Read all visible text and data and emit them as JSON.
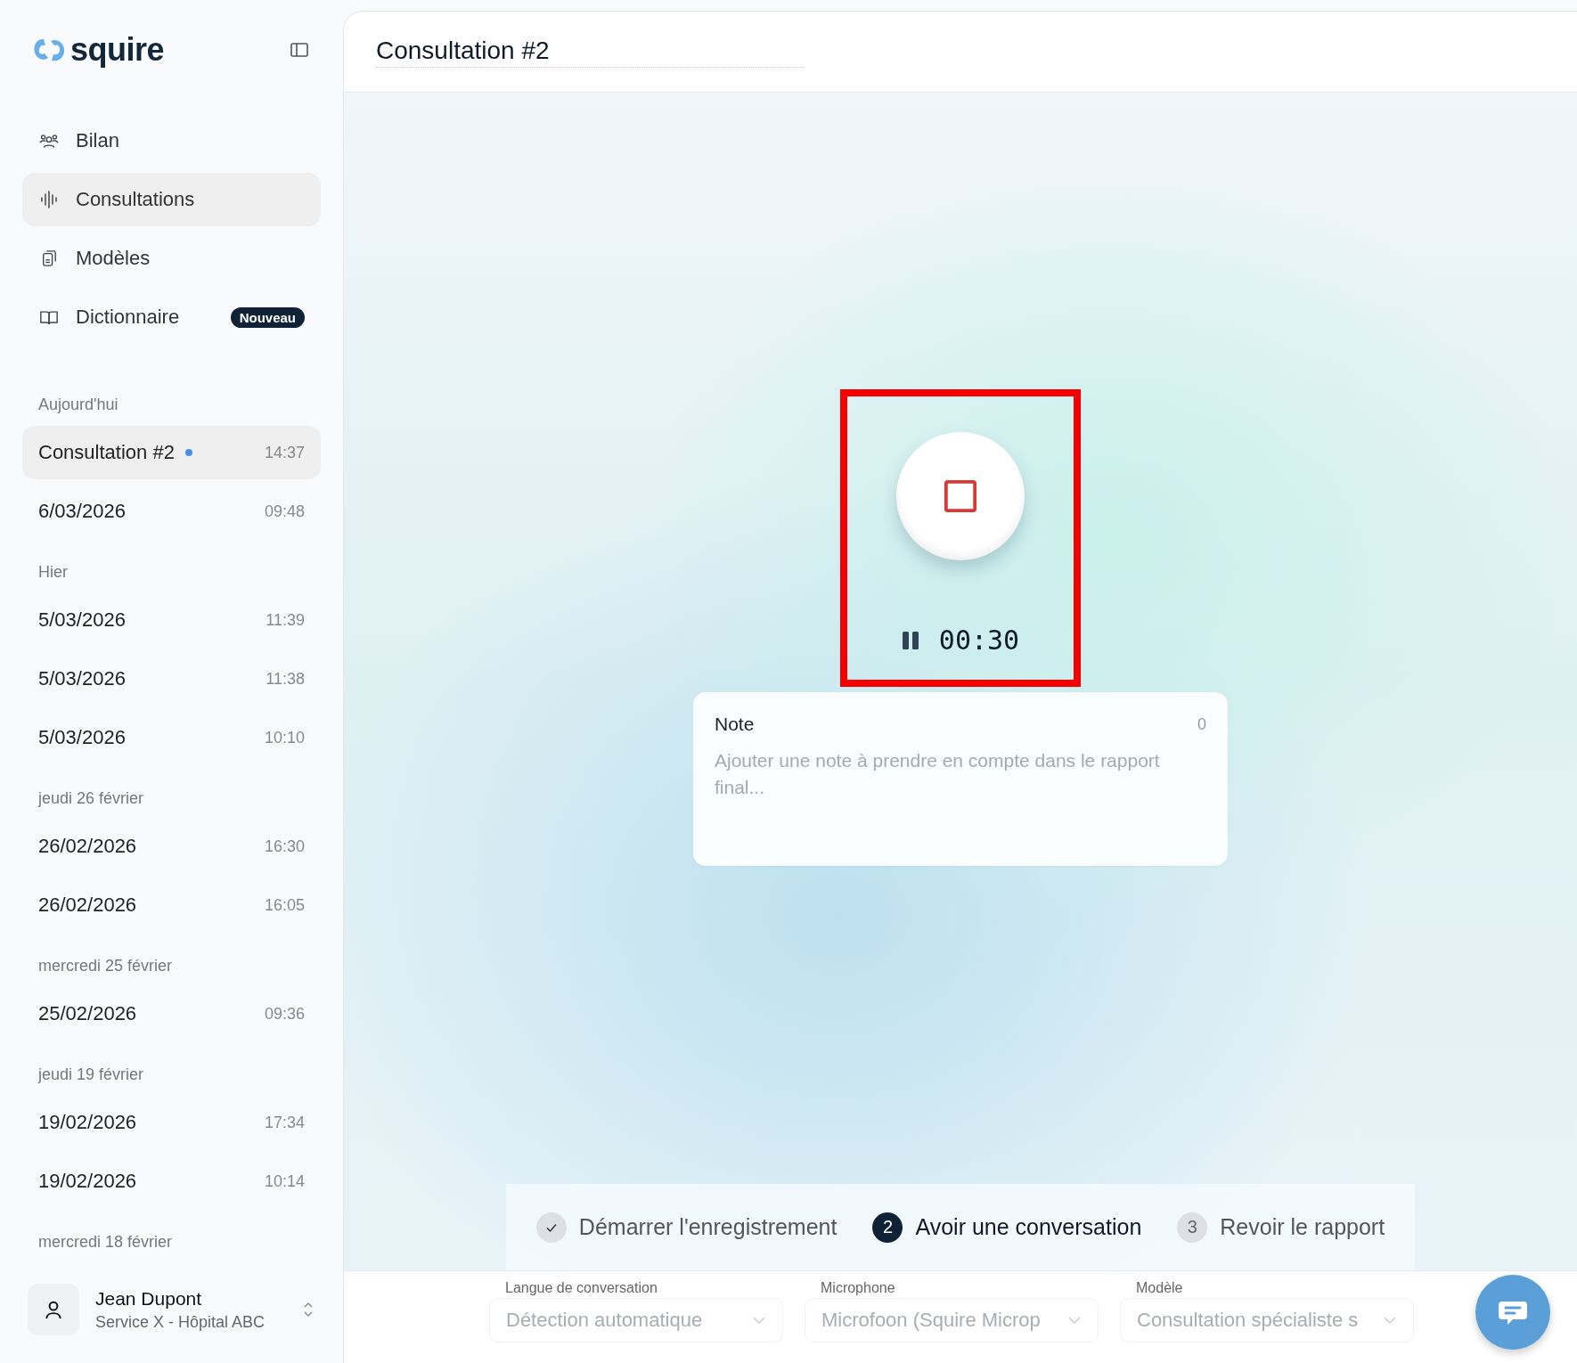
{
  "brand": {
    "name": "squire"
  },
  "nav": [
    {
      "label": "Bilan",
      "selected": false
    },
    {
      "label": "Consultations",
      "selected": true
    },
    {
      "label": "Modèles",
      "selected": false
    },
    {
      "label": "Dictionnaire",
      "selected": false,
      "badge": "Nouveau"
    }
  ],
  "history": [
    {
      "heading": "Aujourd'hui",
      "items": [
        {
          "title": "Consultation #2",
          "time": "14:37",
          "selected": true,
          "recording": true
        },
        {
          "title": "6/03/2026",
          "time": "09:48",
          "selected": false,
          "recording": false
        }
      ]
    },
    {
      "heading": "Hier",
      "items": [
        {
          "title": "5/03/2026",
          "time": "11:39",
          "selected": false,
          "recording": false
        },
        {
          "title": "5/03/2026",
          "time": "11:38",
          "selected": false,
          "recording": false
        },
        {
          "title": "5/03/2026",
          "time": "10:10",
          "selected": false,
          "recording": false
        }
      ]
    },
    {
      "heading": "jeudi 26 février",
      "items": [
        {
          "title": "26/02/2026",
          "time": "16:30",
          "selected": false,
          "recording": false
        },
        {
          "title": "26/02/2026",
          "time": "16:05",
          "selected": false,
          "recording": false
        }
      ]
    },
    {
      "heading": "mercredi 25 février",
      "items": [
        {
          "title": "25/02/2026",
          "time": "09:36",
          "selected": false,
          "recording": false
        }
      ]
    },
    {
      "heading": "jeudi 19 février",
      "items": [
        {
          "title": "19/02/2026",
          "time": "17:34",
          "selected": false,
          "recording": false
        },
        {
          "title": "19/02/2026",
          "time": "10:14",
          "selected": false,
          "recording": false
        }
      ]
    },
    {
      "heading": "mercredi 18 février"
    }
  ],
  "user": {
    "name": "Jean Dupont",
    "subtitle": "Service X - Hôpital ABC"
  },
  "page": {
    "title": "Consultation #2"
  },
  "recorder": {
    "timer": "00:30",
    "highlighted": true
  },
  "note": {
    "label": "Note",
    "count": "0",
    "placeholder": "Ajouter une note à prendre en compte dans le rapport final..."
  },
  "steps": [
    {
      "label": "Démarrer l'enregistrement",
      "done": true,
      "selected": false
    },
    {
      "number": "2",
      "label": "Avoir une conversation",
      "done": false,
      "selected": true
    },
    {
      "number": "3",
      "label": "Revoir le rapport",
      "done": false,
      "selected": false
    }
  ],
  "settings": [
    {
      "label": "Langue de conversation",
      "value": "Détection automatique",
      "disabled": true
    },
    {
      "label": "Microphone",
      "value": "Microfoon (Squire Microp",
      "disabled": true
    },
    {
      "label": "Modèle",
      "value": "Consultation spécialiste s",
      "disabled": true
    }
  ]
}
